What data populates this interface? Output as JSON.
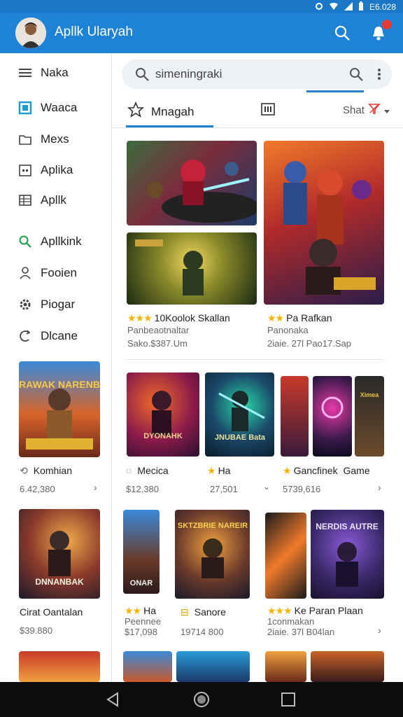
{
  "status": {
    "time": "E6.028"
  },
  "app": {
    "title": "Apllk Ularyah"
  },
  "sidebar": {
    "items": [
      {
        "label": "Naka"
      },
      {
        "label": "Waaca"
      },
      {
        "label": "Mexs"
      },
      {
        "label": "Aplika"
      },
      {
        "label": "Apllk"
      },
      {
        "label": "Apllkink"
      },
      {
        "label": "Fooien"
      },
      {
        "label": "Piogar"
      },
      {
        "label": "Dlcane"
      }
    ]
  },
  "search": {
    "value": "simeningraki",
    "placeholder": ""
  },
  "tabs": [
    {
      "label": "Mnagah"
    },
    {
      "label": ""
    },
    {
      "label": "Shat"
    }
  ],
  "featured": {
    "left": {
      "title": "10Koolok Skallan",
      "subtitle": "Panbeaotnaltar",
      "meta": "Sako.$387.Um"
    },
    "right": {
      "title": "Pa Rafkan",
      "subtitle": "Panonaka",
      "meta": "2iaie. 27l Pao17.Sap"
    }
  },
  "row1": [
    {
      "title": "Komhian",
      "price": "6.42,380",
      "poster_text": "DRAWAK NARENBA"
    },
    {
      "title": "Mecica",
      "price": "$12,380",
      "poster_text": "DYONAHK"
    },
    {
      "title": "Ha",
      "price": "27,501",
      "poster_text": "JNUBAE Bata"
    },
    {
      "title": "Gancfinek",
      "extra": "Game",
      "price": "5739,616",
      "poster_text": "Ximea"
    }
  ],
  "row2": [
    {
      "title": "Cirat Oantalan",
      "price": "$39.880",
      "poster_text": "DNNANBAK"
    },
    {
      "title": "Ha",
      "subtitle": "Peennee",
      "price": "$17,098",
      "poster_text": "ONAR"
    },
    {
      "title": "Sanore",
      "price": "19714 800",
      "poster_text": "SKTZBRIE NAREIR"
    },
    {
      "title": "Ke Paran Plaan",
      "subtitle": "1conmakan",
      "price": "2iaie. 37l B04lan",
      "poster_text": "NERDIS AUTRE"
    }
  ],
  "colors": {
    "appbar": "#1e82d6",
    "accent": "#1e82d6",
    "star": "#f5b400",
    "badge": "#e53935"
  },
  "icons": [
    "search-icon",
    "notifications-icon",
    "menu-icon",
    "back-icon",
    "home-icon",
    "recents-icon"
  ]
}
